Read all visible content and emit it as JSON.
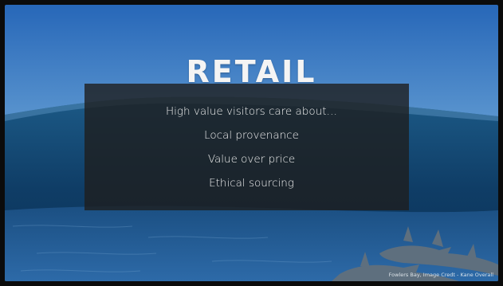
{
  "slide": {
    "title": "RETAIL",
    "bullets": [
      "High value visitors care about…",
      "Local provenance",
      "Value over price",
      "Ethical sourcing"
    ],
    "image_credit": "Fowlers Bay, Image Credt - Kane Overall"
  },
  "colors": {
    "sky_top": "#2c6fc0",
    "sky_bottom": "#b8d3ea",
    "sea": "#123a63",
    "panel": "#1e1e1e",
    "text": "#f2f2f2"
  }
}
